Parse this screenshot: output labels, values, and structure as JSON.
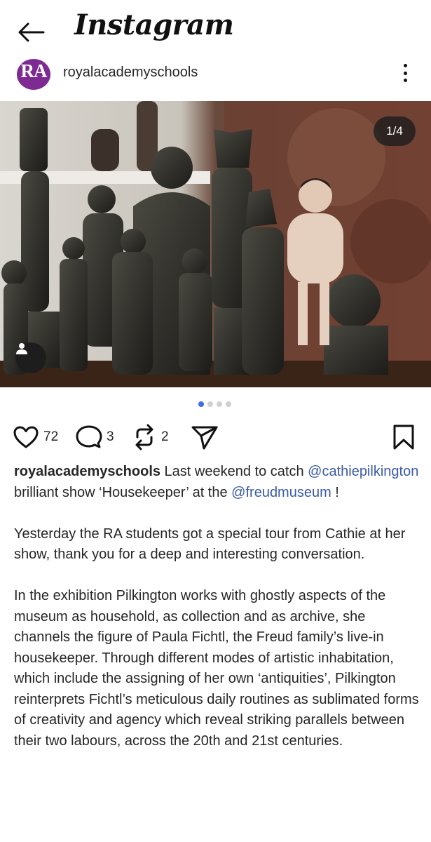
{
  "header": {
    "app_title": "Instagram",
    "back_icon": "arrow-left-icon"
  },
  "post": {
    "username": "royalacademyschools",
    "avatar_text": "RA",
    "avatar_color": "#7d2a93",
    "image_counter": "1/4",
    "carousel": {
      "total": 4,
      "active_index": 0
    },
    "likes": "72",
    "comments": "3",
    "reposts": "2"
  },
  "caption": {
    "username": "royalacademyschools",
    "line1_text": " Last weekend to catch ",
    "mention1": "@cathiepilkington",
    "line1_text2": " brilliant show ‘Housekeeper’ at the ",
    "mention2": "@freudmuseum",
    "line1_end": " !",
    "para2": "Yesterday the RA students got a special tour from Cathie at her show, thank you for a deep and interesting conversation.",
    "para3": "In the exhibition Pilkington works with ghostly aspects of the museum as household, as collection and as archive, she channels the figure of Paula Fichtl, the Freud family’s live-in housekeeper. Through different modes of artistic inhabitation, which include the assigning of her own ‘antiquities’, Pilkington reinterprets Fichtl’s meticulous daily routines as sublimated forms of creativity and agency which reveal striking parallels between their two labours, across the 20th and 21st centuries."
  },
  "colors": {
    "mention": "#3b5ba8",
    "dot_active": "#3f6ee8",
    "dot_inactive": "#d0d0d0"
  }
}
